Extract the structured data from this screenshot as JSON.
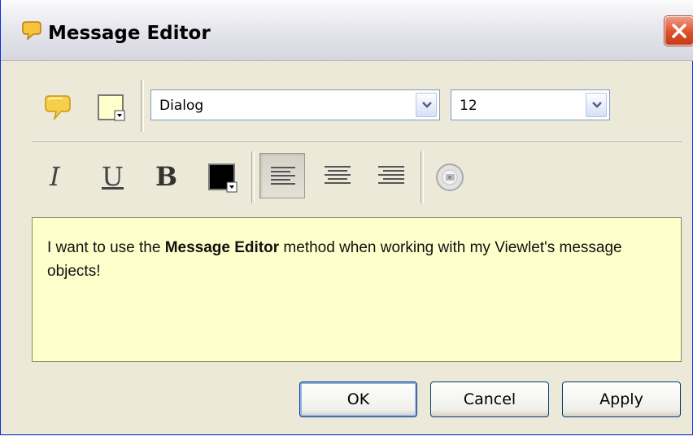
{
  "window": {
    "title": "Message Editor"
  },
  "toolbar": {
    "font_family": "Dialog",
    "font_size": "12",
    "message_icon": "message-bubble-icon",
    "fill_color": "#ffffcc",
    "text_color": "#000000"
  },
  "format": {
    "italic": "I",
    "underline": "U",
    "bold": "B"
  },
  "editor": {
    "text_before": "I want to use the ",
    "text_bold": "Message Editor",
    "text_after": " method when working with my Viewlet's message objects!"
  },
  "buttons": {
    "ok": "OK",
    "cancel": "Cancel",
    "apply": "Apply"
  },
  "colors": {
    "editor_bg": "#ffffcc",
    "dialog_bg": "#ece9d8",
    "close_red": "#de4f2c"
  }
}
